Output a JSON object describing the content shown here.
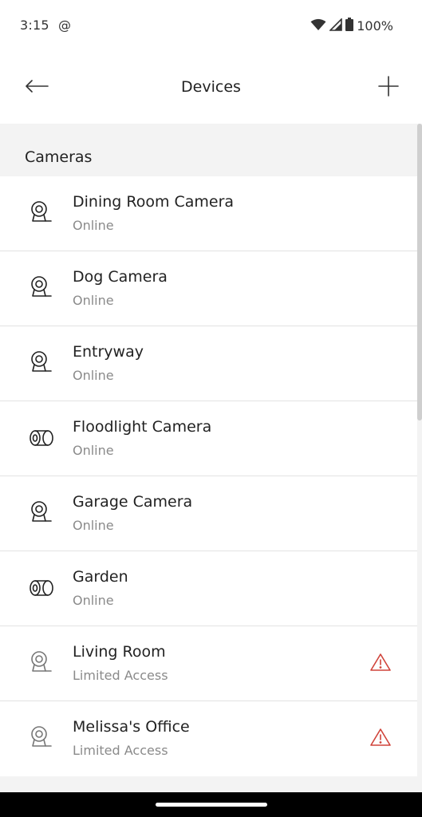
{
  "status_bar": {
    "time": "3:15",
    "at_symbol": "@",
    "battery": "100%"
  },
  "header": {
    "title": "Devices",
    "back_icon": "arrow-left-icon",
    "add_icon": "plus-icon"
  },
  "section": {
    "label": "Cameras"
  },
  "devices": [
    {
      "name": "Dining Room Camera",
      "status": "Online",
      "icon": "indoor-camera-icon",
      "warning": false
    },
    {
      "name": "Dog Camera",
      "status": "Online",
      "icon": "indoor-camera-icon",
      "warning": false
    },
    {
      "name": "Entryway",
      "status": "Online",
      "icon": "indoor-camera-icon",
      "warning": false
    },
    {
      "name": "Floodlight Camera",
      "status": "Online",
      "icon": "floodlight-camera-icon",
      "warning": false
    },
    {
      "name": "Garage Camera",
      "status": "Online",
      "icon": "indoor-camera-icon",
      "warning": false
    },
    {
      "name": "Garden",
      "status": "Online",
      "icon": "floodlight-camera-icon",
      "warning": false
    },
    {
      "name": "Living Room",
      "status": "Limited Access",
      "icon": "indoor-camera-icon",
      "warning": true
    },
    {
      "name": "Melissa's Office",
      "status": "Limited Access",
      "icon": "indoor-camera-icon",
      "warning": true
    }
  ],
  "colors": {
    "background": "#f3f3f3",
    "surface": "#ffffff",
    "text_primary": "#222222",
    "text_secondary": "#8a8a8a",
    "warning": "#d0433a"
  }
}
